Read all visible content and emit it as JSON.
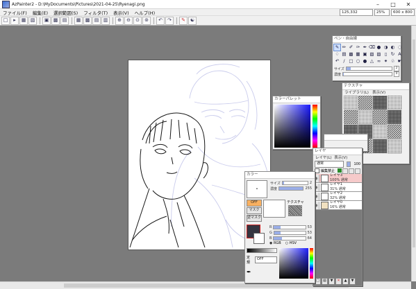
{
  "window": {
    "title": "AzPainter2 - D:\\MyDocuments\\Pictures\\2021-04-25\\Ryenagi.png"
  },
  "menu": [
    "ファイル(F)",
    "編集(E)",
    "選択範囲(S)",
    "フィルタ(T)",
    "表示(V)",
    "ヘルプ(H)"
  ],
  "status": {
    "coords": "125,332",
    "mode": "25%",
    "size": "600 x 800"
  },
  "tool_window": {
    "title": "ペン・自由線",
    "size_label": "サイズ",
    "size_value": "2",
    "density_label": "濃度",
    "density_value": "0"
  },
  "texture_window": {
    "title": "テクスチャ",
    "menu": [
      "ライブラリ(L)",
      "表示(V)"
    ]
  },
  "palette_window": {
    "title": "カラーパレット"
  },
  "layer_window": {
    "title": "レイヤ",
    "menu": [
      "レイヤ(L)",
      "表示(V)"
    ],
    "blend_mode": "通常",
    "opacity": "100",
    "checkbox_label": "編集禁止",
    "layers": [
      {
        "name": "レイヤ3",
        "info": "100% 通常"
      },
      {
        "name": "レイヤ1",
        "info": "31% 通常"
      },
      {
        "name": "レイヤ2",
        "info": "32% 通常"
      },
      {
        "name": "レイヤ0",
        "info": "16% 通常"
      }
    ]
  },
  "color_window": {
    "title": "カラー",
    "size_label": "サイズ",
    "size_value": "2",
    "density_label": "濃度",
    "density_value": "255",
    "off_label": "OFF",
    "mask_label": "マスク",
    "mask2_label": "逆マスク",
    "tex_label": "テクスチャ",
    "r_label": "R",
    "r_value": "53",
    "g_label": "G",
    "g_value": "53",
    "b_label": "B",
    "b_value": "64",
    "rgb_label": "RGB",
    "hsv_label": "HSV",
    "mode_label": "定規",
    "mode_value": "OFF"
  }
}
